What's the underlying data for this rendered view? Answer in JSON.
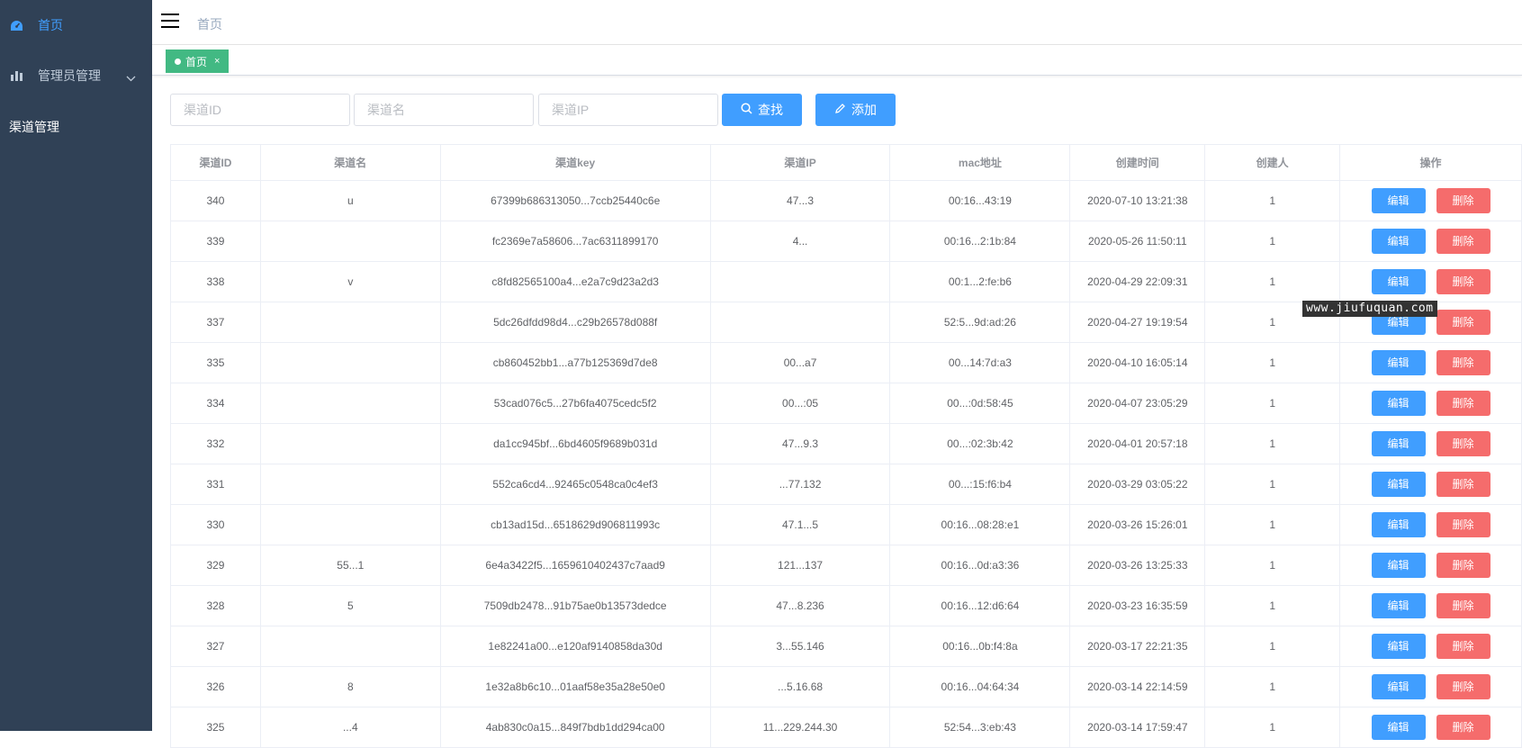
{
  "sidebar": {
    "items": [
      {
        "label": "首页",
        "icon": "dashboard-icon",
        "active": true
      },
      {
        "label": "管理员管理",
        "icon": "bar-chart-icon",
        "active": false
      },
      {
        "label": "渠道管理",
        "icon": "",
        "active": false
      }
    ]
  },
  "navbar": {
    "breadcrumb": "首页"
  },
  "tags": [
    {
      "label": "首页",
      "close": "×"
    }
  ],
  "filters": {
    "id_placeholder": "渠道ID",
    "name_placeholder": "渠道名",
    "ip_placeholder": "渠道IP",
    "search_label": "查找",
    "add_label": "添加"
  },
  "table": {
    "headers": [
      "渠道ID",
      "渠道名",
      "渠道key",
      "渠道IP",
      "mac地址",
      "创建时间",
      "创建人",
      "操作"
    ],
    "edit_label": "编辑",
    "delete_label": "删除",
    "rows": [
      {
        "id": "340",
        "name": "u",
        "key": "67399b686313050...7ccb25440c6e",
        "ip": "47...3",
        "mac": "00:16...43:19",
        "created": "2020-07-10 13:21:38",
        "creator": "1"
      },
      {
        "id": "339",
        "name": "",
        "key": "fc2369e7a58606...7ac6311899170",
        "ip": "4...",
        "mac": "00:16...2:1b:84",
        "created": "2020-05-26 11:50:11",
        "creator": "1"
      },
      {
        "id": "338",
        "name": "v",
        "key": "c8fd82565100a4...e2a7c9d23a2d3",
        "ip": "",
        "mac": "00:1...2:fe:b6",
        "created": "2020-04-29 22:09:31",
        "creator": "1"
      },
      {
        "id": "337",
        "name": "",
        "key": "5dc26dfdd98d4...c29b26578d088f",
        "ip": "",
        "mac": "52:5...9d:ad:26",
        "created": "2020-04-27 19:19:54",
        "creator": "1"
      },
      {
        "id": "335",
        "name": "",
        "key": "cb860452bb1...a77b125369d7de8",
        "ip": "00...a7",
        "mac": "00...14:7d:a3",
        "created": "2020-04-10 16:05:14",
        "creator": "1"
      },
      {
        "id": "334",
        "name": "",
        "key": "53cad076c5...27b6fa4075cedc5f2",
        "ip": "00...:05",
        "mac": "00...:0d:58:45",
        "created": "2020-04-07 23:05:29",
        "creator": "1"
      },
      {
        "id": "332",
        "name": "",
        "key": "da1cc945bf...6bd4605f9689b031d",
        "ip": "47...9.3",
        "mac": "00...:02:3b:42",
        "created": "2020-04-01 20:57:18",
        "creator": "1"
      },
      {
        "id": "331",
        "name": "",
        "key": "552ca6cd4...92465c0548ca0c4ef3",
        "ip": "...77.132",
        "mac": "00...:15:f6:b4",
        "created": "2020-03-29 03:05:22",
        "creator": "1"
      },
      {
        "id": "330",
        "name": "",
        "key": "cb13ad15d...6518629d906811993c",
        "ip": "47.1...5",
        "mac": "00:16...08:28:e1",
        "created": "2020-03-26 15:26:01",
        "creator": "1"
      },
      {
        "id": "329",
        "name": "55...1",
        "key": "6e4a3422f5...1659610402437c7aad9",
        "ip": "121...137",
        "mac": "00:16...0d:a3:36",
        "created": "2020-03-26 13:25:33",
        "creator": "1"
      },
      {
        "id": "328",
        "name": "5",
        "key": "7509db2478...91b75ae0b13573dedce",
        "ip": "47...8.236",
        "mac": "00:16...12:d6:64",
        "created": "2020-03-23 16:35:59",
        "creator": "1"
      },
      {
        "id": "327",
        "name": "",
        "key": "1e82241a00...e120af9140858da30d",
        "ip": "3...55.146",
        "mac": "00:16...0b:f4:8a",
        "created": "2020-03-17 22:21:35",
        "creator": "1"
      },
      {
        "id": "326",
        "name": "8",
        "key": "1e32a8b6c10...01aaf58e35a28e50e0",
        "ip": "...5.16.68",
        "mac": "00:16...04:64:34",
        "created": "2020-03-14 22:14:59",
        "creator": "1"
      },
      {
        "id": "325",
        "name": "...4",
        "key": "4ab830c0a15...849f7bdb1dd294ca00",
        "ip": "11...229.244.30",
        "mac": "52:54...3:eb:43",
        "created": "2020-03-14 17:59:47",
        "creator": "1"
      }
    ]
  },
  "watermark": "www.jiufuquan.com"
}
